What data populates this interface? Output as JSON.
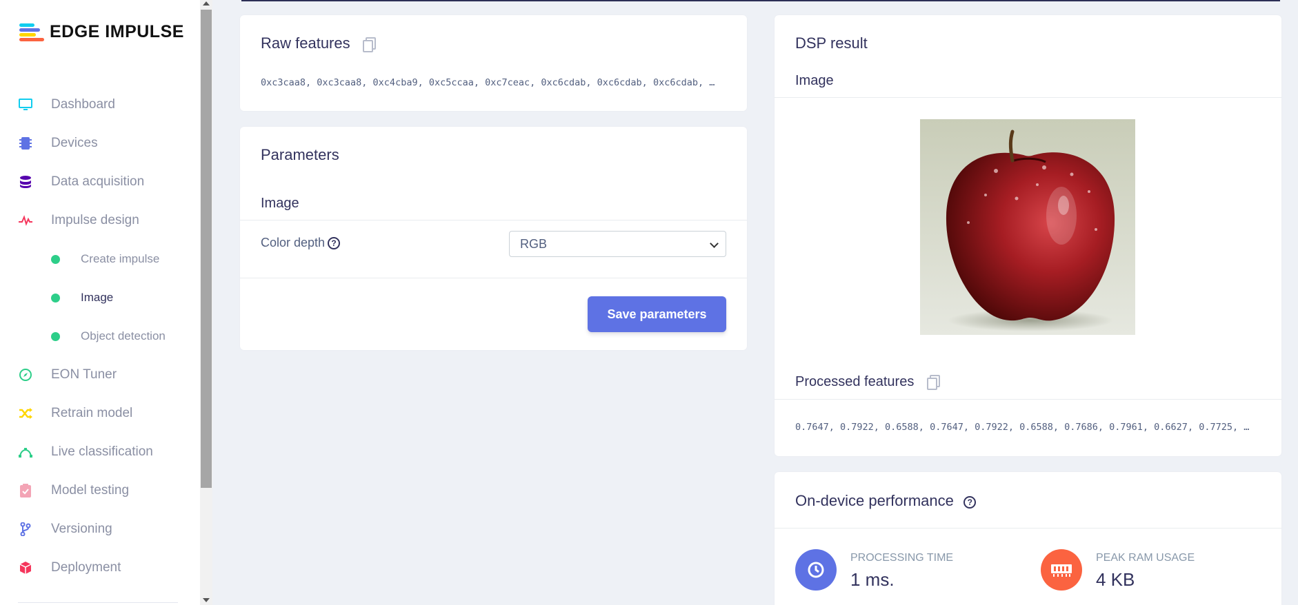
{
  "brand": {
    "name": "EDGE IMPULSE"
  },
  "sidebar": {
    "items": [
      {
        "label": "Dashboard",
        "icon": "monitor-icon",
        "color": "#11cdef"
      },
      {
        "label": "Devices",
        "icon": "chip-icon",
        "color": "#5e72e4"
      },
      {
        "label": "Data acquisition",
        "icon": "database-icon",
        "color": "#5603ad"
      },
      {
        "label": "Impulse design",
        "icon": "pulse-icon",
        "color": "#f5365c"
      },
      {
        "label": "EON Tuner",
        "icon": "compass-icon",
        "color": "#2dce89"
      },
      {
        "label": "Retrain model",
        "icon": "shuffle-icon",
        "color": "#ffd600"
      },
      {
        "label": "Live classification",
        "icon": "bezier-icon",
        "color": "#2dce89"
      },
      {
        "label": "Model testing",
        "icon": "clipboard-check-icon",
        "color": "#f3a4b5"
      },
      {
        "label": "Versioning",
        "icon": "branch-icon",
        "color": "#5e72e4"
      },
      {
        "label": "Deployment",
        "icon": "cube-icon",
        "color": "#f5365c"
      }
    ],
    "subitems": [
      {
        "label": "Create impulse"
      },
      {
        "label": "Image"
      },
      {
        "label": "Object detection"
      }
    ]
  },
  "raw_features": {
    "title": "Raw features",
    "values": "0xc3caa8, 0xc3caa8, 0xc4cba9, 0xc5ccaa, 0xc7ceac, 0xc6cdab, 0xc6cdab, 0xc6cdab, …"
  },
  "parameters": {
    "title": "Parameters",
    "section": "Image",
    "color_depth_label": "Color depth",
    "color_depth_value": "RGB",
    "save_label": "Save parameters"
  },
  "dsp_result": {
    "title": "DSP result",
    "image_label": "Image",
    "processed_title": "Processed features",
    "processed_values": "0.7647, 0.7922, 0.6588, 0.7647, 0.7922, 0.6588, 0.7686, 0.7961, 0.6627, 0.7725, …"
  },
  "performance": {
    "title": "On-device performance",
    "processing_label": "PROCESSING TIME",
    "processing_value": "1 ms.",
    "ram_label": "PEAK RAM USAGE",
    "ram_value": "4 KB"
  },
  "colors": {
    "accent": "#5e72e4",
    "ram": "#fb6340",
    "success": "#2dce89"
  }
}
